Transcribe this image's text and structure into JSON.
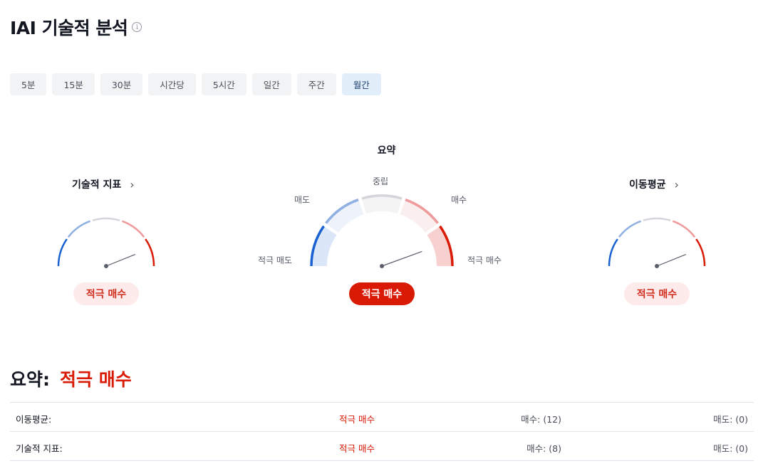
{
  "header": {
    "title": "IAI 기술적 분석",
    "info_icon": "info-icon"
  },
  "tabs": [
    {
      "label": "5분",
      "active": false
    },
    {
      "label": "15분",
      "active": false
    },
    {
      "label": "30분",
      "active": false
    },
    {
      "label": "시간당",
      "active": false
    },
    {
      "label": "5시간",
      "active": false
    },
    {
      "label": "일간",
      "active": false
    },
    {
      "label": "주간",
      "active": false
    },
    {
      "label": "월간",
      "active": true
    }
  ],
  "gauges": {
    "oscillators": {
      "title": "기술적 지표",
      "verdict": "적극 매수"
    },
    "summary": {
      "title": "요약",
      "verdict": "적극 매수",
      "labels": {
        "strong_sell": "적극 매도",
        "sell": "매도",
        "neutral": "중립",
        "buy": "매수",
        "strong_buy": "적극 매수"
      }
    },
    "moving_averages": {
      "title": "이동평균",
      "verdict": "적극 매수"
    }
  },
  "summary_section": {
    "label": "요약:",
    "verdict": "적극 매수",
    "rows": [
      {
        "name": "이동평균:",
        "verdict": "적극 매수",
        "buy": "매수: (12)",
        "sell": "매도: (0)"
      },
      {
        "name": "기술적 지표:",
        "verdict": "적극 매수",
        "buy": "매수: (8)",
        "sell": "매도: (0)"
      }
    ]
  },
  "colors": {
    "strong_sell": "#1a62d1",
    "sell": "#8fb0e0",
    "neutral": "#d3d5da",
    "buy": "#ef9a9a",
    "strong_buy": "#d91a05"
  }
}
